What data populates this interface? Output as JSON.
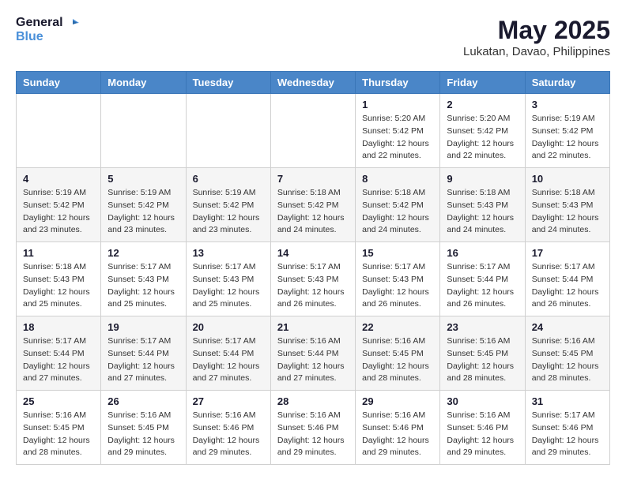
{
  "logo": {
    "line1": "General",
    "line2": "Blue"
  },
  "title": "May 2025",
  "location": "Lukatan, Davao, Philippines",
  "days_of_week": [
    "Sunday",
    "Monday",
    "Tuesday",
    "Wednesday",
    "Thursday",
    "Friday",
    "Saturday"
  ],
  "weeks": [
    [
      {
        "day": "",
        "info": ""
      },
      {
        "day": "",
        "info": ""
      },
      {
        "day": "",
        "info": ""
      },
      {
        "day": "",
        "info": ""
      },
      {
        "day": "1",
        "info": "Sunrise: 5:20 AM\nSunset: 5:42 PM\nDaylight: 12 hours\nand 22 minutes."
      },
      {
        "day": "2",
        "info": "Sunrise: 5:20 AM\nSunset: 5:42 PM\nDaylight: 12 hours\nand 22 minutes."
      },
      {
        "day": "3",
        "info": "Sunrise: 5:19 AM\nSunset: 5:42 PM\nDaylight: 12 hours\nand 22 minutes."
      }
    ],
    [
      {
        "day": "4",
        "info": "Sunrise: 5:19 AM\nSunset: 5:42 PM\nDaylight: 12 hours\nand 23 minutes."
      },
      {
        "day": "5",
        "info": "Sunrise: 5:19 AM\nSunset: 5:42 PM\nDaylight: 12 hours\nand 23 minutes."
      },
      {
        "day": "6",
        "info": "Sunrise: 5:19 AM\nSunset: 5:42 PM\nDaylight: 12 hours\nand 23 minutes."
      },
      {
        "day": "7",
        "info": "Sunrise: 5:18 AM\nSunset: 5:42 PM\nDaylight: 12 hours\nand 24 minutes."
      },
      {
        "day": "8",
        "info": "Sunrise: 5:18 AM\nSunset: 5:42 PM\nDaylight: 12 hours\nand 24 minutes."
      },
      {
        "day": "9",
        "info": "Sunrise: 5:18 AM\nSunset: 5:43 PM\nDaylight: 12 hours\nand 24 minutes."
      },
      {
        "day": "10",
        "info": "Sunrise: 5:18 AM\nSunset: 5:43 PM\nDaylight: 12 hours\nand 24 minutes."
      }
    ],
    [
      {
        "day": "11",
        "info": "Sunrise: 5:18 AM\nSunset: 5:43 PM\nDaylight: 12 hours\nand 25 minutes."
      },
      {
        "day": "12",
        "info": "Sunrise: 5:17 AM\nSunset: 5:43 PM\nDaylight: 12 hours\nand 25 minutes."
      },
      {
        "day": "13",
        "info": "Sunrise: 5:17 AM\nSunset: 5:43 PM\nDaylight: 12 hours\nand 25 minutes."
      },
      {
        "day": "14",
        "info": "Sunrise: 5:17 AM\nSunset: 5:43 PM\nDaylight: 12 hours\nand 26 minutes."
      },
      {
        "day": "15",
        "info": "Sunrise: 5:17 AM\nSunset: 5:43 PM\nDaylight: 12 hours\nand 26 minutes."
      },
      {
        "day": "16",
        "info": "Sunrise: 5:17 AM\nSunset: 5:44 PM\nDaylight: 12 hours\nand 26 minutes."
      },
      {
        "day": "17",
        "info": "Sunrise: 5:17 AM\nSunset: 5:44 PM\nDaylight: 12 hours\nand 26 minutes."
      }
    ],
    [
      {
        "day": "18",
        "info": "Sunrise: 5:17 AM\nSunset: 5:44 PM\nDaylight: 12 hours\nand 27 minutes."
      },
      {
        "day": "19",
        "info": "Sunrise: 5:17 AM\nSunset: 5:44 PM\nDaylight: 12 hours\nand 27 minutes."
      },
      {
        "day": "20",
        "info": "Sunrise: 5:17 AM\nSunset: 5:44 PM\nDaylight: 12 hours\nand 27 minutes."
      },
      {
        "day": "21",
        "info": "Sunrise: 5:16 AM\nSunset: 5:44 PM\nDaylight: 12 hours\nand 27 minutes."
      },
      {
        "day": "22",
        "info": "Sunrise: 5:16 AM\nSunset: 5:45 PM\nDaylight: 12 hours\nand 28 minutes."
      },
      {
        "day": "23",
        "info": "Sunrise: 5:16 AM\nSunset: 5:45 PM\nDaylight: 12 hours\nand 28 minutes."
      },
      {
        "day": "24",
        "info": "Sunrise: 5:16 AM\nSunset: 5:45 PM\nDaylight: 12 hours\nand 28 minutes."
      }
    ],
    [
      {
        "day": "25",
        "info": "Sunrise: 5:16 AM\nSunset: 5:45 PM\nDaylight: 12 hours\nand 28 minutes."
      },
      {
        "day": "26",
        "info": "Sunrise: 5:16 AM\nSunset: 5:45 PM\nDaylight: 12 hours\nand 29 minutes."
      },
      {
        "day": "27",
        "info": "Sunrise: 5:16 AM\nSunset: 5:46 PM\nDaylight: 12 hours\nand 29 minutes."
      },
      {
        "day": "28",
        "info": "Sunrise: 5:16 AM\nSunset: 5:46 PM\nDaylight: 12 hours\nand 29 minutes."
      },
      {
        "day": "29",
        "info": "Sunrise: 5:16 AM\nSunset: 5:46 PM\nDaylight: 12 hours\nand 29 minutes."
      },
      {
        "day": "30",
        "info": "Sunrise: 5:16 AM\nSunset: 5:46 PM\nDaylight: 12 hours\nand 29 minutes."
      },
      {
        "day": "31",
        "info": "Sunrise: 5:17 AM\nSunset: 5:46 PM\nDaylight: 12 hours\nand 29 minutes."
      }
    ]
  ]
}
